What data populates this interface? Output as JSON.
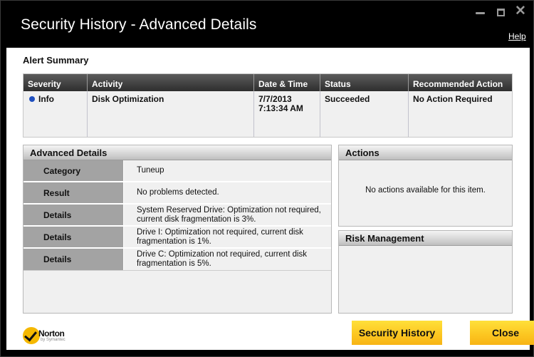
{
  "window": {
    "title": "Security History - Advanced Details",
    "help_label": "Help"
  },
  "alert_summary": {
    "title": "Alert Summary",
    "columns": [
      "Severity",
      "Activity",
      "Date & Time",
      "Status",
      "Recommended Action"
    ],
    "row": {
      "severity": "Info",
      "severity_color": "#1f4fbf",
      "activity": "Disk Optimization",
      "date": "7/7/2013",
      "time": "7:13:34 AM",
      "status": "Succeeded",
      "recommended_action": "No Action Required"
    }
  },
  "advanced_details": {
    "title": "Advanced Details",
    "rows": [
      {
        "key": "Category",
        "value": "Tuneup"
      },
      {
        "key": "Result",
        "value": "No problems detected."
      },
      {
        "key": "Details",
        "value": "System Reserved Drive: Optimization not required, current disk fragmentation is 3%."
      },
      {
        "key": "Details",
        "value": "Drive I: Optimization not required, current disk fragmentation is 1%."
      },
      {
        "key": "Details",
        "value": "Drive C: Optimization not required, current disk fragmentation is 5%."
      }
    ]
  },
  "actions": {
    "title": "Actions",
    "message": "No actions available for this item."
  },
  "risk_management": {
    "title": "Risk Management"
  },
  "logo": {
    "name": "Norton",
    "sub": "by Symantec"
  },
  "buttons": {
    "security_history": "Security History",
    "close": "Close"
  }
}
